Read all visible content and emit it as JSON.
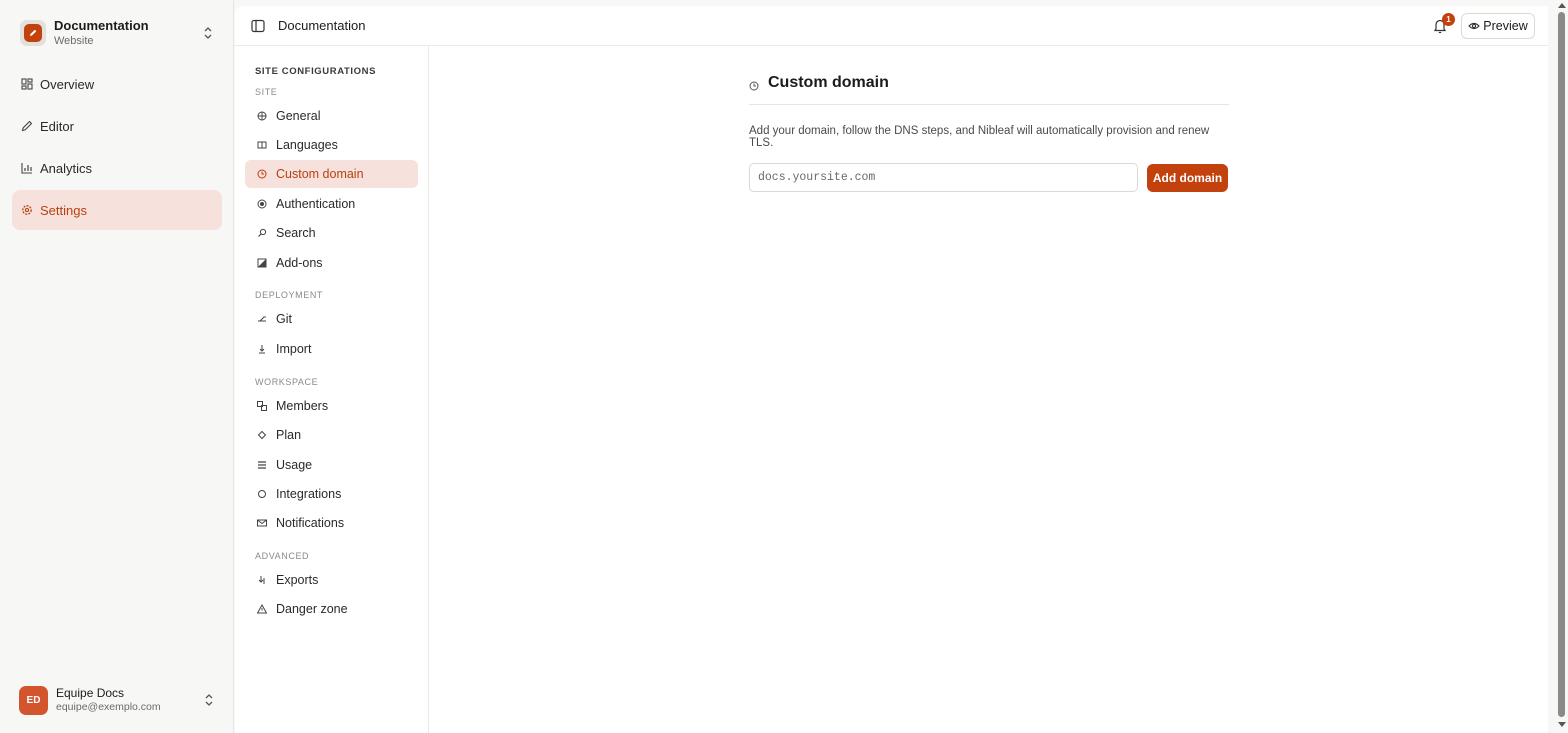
{
  "colors": {
    "accent": "#c2410c",
    "active_bg": "#f6e1dc",
    "active_text": "#b8410f"
  },
  "workspace": {
    "name": "Documentation",
    "subtitle": "Website",
    "icon": "pencil-logo-icon"
  },
  "nav": [
    {
      "label": "Overview",
      "icon": "dashboard-icon"
    },
    {
      "label": "Editor",
      "icon": "pen-icon"
    },
    {
      "label": "Analytics",
      "icon": "bar-chart-icon"
    },
    {
      "label": "Settings",
      "icon": "gear-icon",
      "active": true
    }
  ],
  "user": {
    "initials": "ED",
    "name": "Equipe Docs",
    "email": "equipe@exemplo.com"
  },
  "topbar": {
    "breadcrumb": "Documentation",
    "notification_count": "1",
    "preview_label": "Preview"
  },
  "settings": {
    "title": "SITE CONFIGURATIONS",
    "groups": {
      "site": "SITE",
      "deployment": "DEPLOYMENT",
      "workspace": "WORKSPACE",
      "advanced": "ADVANCED"
    },
    "items": {
      "general": "General",
      "languages": "Languages",
      "custom_domain": "Custom domain",
      "authentication": "Authentication",
      "search": "Search",
      "addons": "Add-ons",
      "git": "Git",
      "import": "Import",
      "members": "Members",
      "plan": "Plan",
      "usage": "Usage",
      "integrations": "Integrations",
      "notifications": "Notifications",
      "exports": "Exports",
      "danger_zone": "Danger zone"
    },
    "active": "custom_domain"
  },
  "content": {
    "title": "Custom domain",
    "description": "Add your domain, follow the DNS steps, and Nibleaf will automatically provision and renew TLS.",
    "input_placeholder": "docs.yoursite.com",
    "input_value": "",
    "button_label": "Add domain"
  }
}
